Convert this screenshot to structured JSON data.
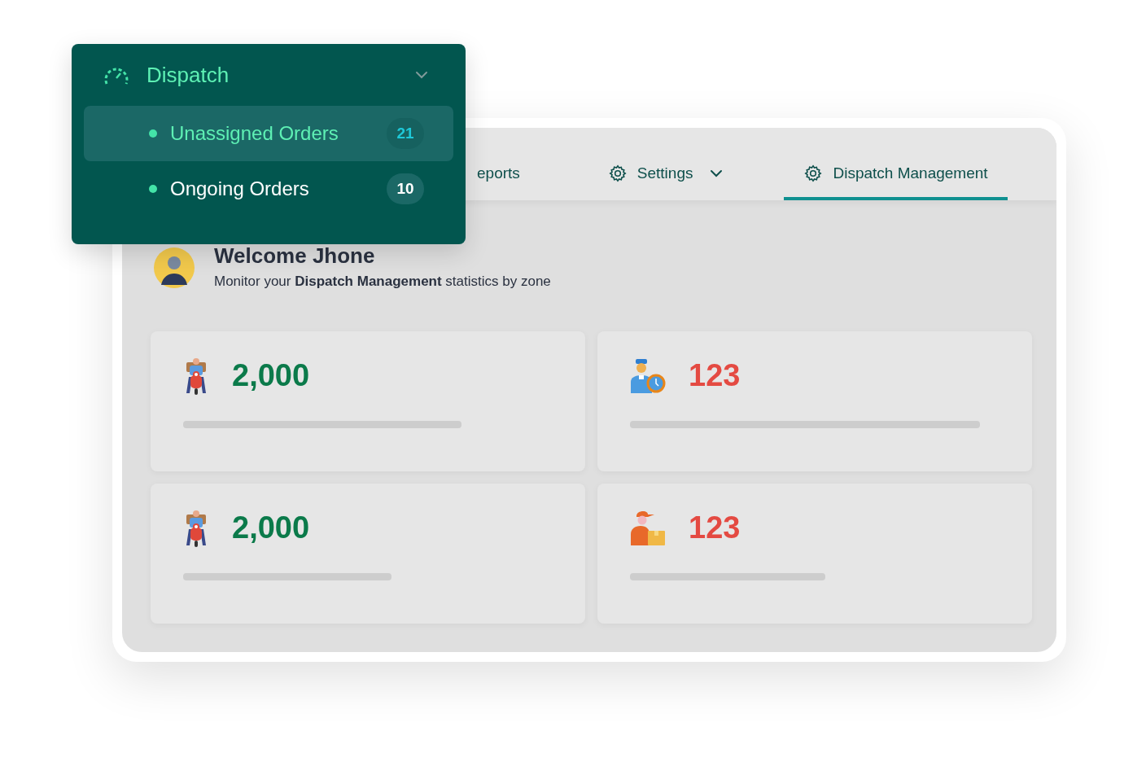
{
  "menu": {
    "title": "Dispatch",
    "expanded": true,
    "items": [
      {
        "label": "Unassigned Orders",
        "count": "21",
        "selected": true
      },
      {
        "label": "Ongoing Orders",
        "count": "10",
        "selected": false
      }
    ]
  },
  "tabs": [
    {
      "label": "eports",
      "kind": "plain",
      "selected": false
    },
    {
      "label": "Settings",
      "kind": "dropdown",
      "selected": false
    },
    {
      "label": "Dispatch Management",
      "kind": "gear",
      "selected": true
    }
  ],
  "welcome": {
    "title": "Welcome Jhone",
    "subtitle": "Monitor your **Dispatch Management** statistics by zone"
  },
  "cards": [
    {
      "value": "2,000",
      "kind": "rider",
      "color": "#0b7a4a"
    },
    {
      "value": "123",
      "kind": "worker",
      "color": "#e44a42"
    },
    {
      "value": "2,000",
      "kind": "rider",
      "color": "#0b7a4a"
    },
    {
      "value": "123",
      "kind": "courier",
      "color": "#e44a42"
    }
  ]
}
